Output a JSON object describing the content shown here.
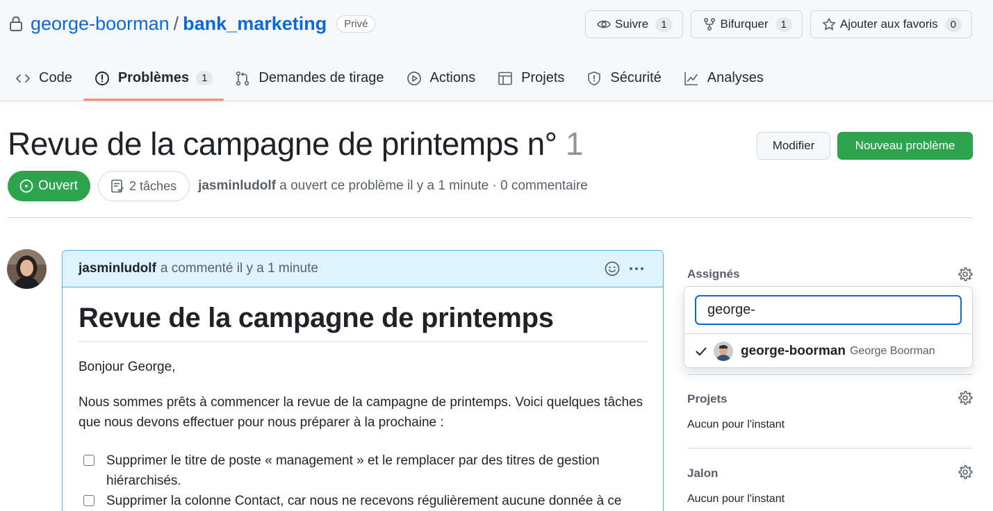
{
  "repo": {
    "owner": "george-boorman",
    "separator": "/",
    "name": "bank_marketing",
    "visibility": "Privé",
    "watch": {
      "label": "Suivre",
      "count": "1"
    },
    "fork": {
      "label": "Bifurquer",
      "count": "1"
    },
    "star": {
      "label": "Ajouter aux favoris",
      "count": "0"
    }
  },
  "tabs": [
    {
      "label": "Code",
      "icon": "code-icon"
    },
    {
      "label": "Problèmes",
      "icon": "issue-opened-icon",
      "count": "1",
      "active": true
    },
    {
      "label": "Demandes de tirage",
      "icon": "git-pull-request-icon"
    },
    {
      "label": "Actions",
      "icon": "play-icon"
    },
    {
      "label": "Projets",
      "icon": "table-icon"
    },
    {
      "label": "Sécurité",
      "icon": "shield-icon"
    },
    {
      "label": "Analyses",
      "icon": "graph-icon"
    }
  ],
  "issue": {
    "title": "Revue de la campagne de printemps n°",
    "number": "1",
    "edit_label": "Modifier",
    "new_issue_label": "Nouveau problème",
    "state": "Ouvert",
    "tasks": "2 tâches",
    "author": "jasminludolf",
    "meta_text": "a ouvert ce problème il y a 1 minute · 0 commentaire"
  },
  "comment": {
    "author": "jasminludolf",
    "header_text": "a commenté il y a 1 minute",
    "heading": "Revue de la campagne de printemps",
    "greeting": "Bonjour George,",
    "paragraph": "Nous sommes prêts à commencer la revue de la campagne de printemps. Voici quelques tâches que nous devons effectuer pour nous préparer à la prochaine :",
    "tasks": [
      "Supprimer le titre de poste « management » et le remplacer par des titres de gestion hiérarchisés.",
      "Supprimer la colonne Contact, car nous ne recevons régulièrement aucune donnée à ce"
    ]
  },
  "sidebar": {
    "assignees_label": "Assignés",
    "search_value": "george-",
    "assignee_login": "george-boorman",
    "assignee_name": "George Boorman",
    "projects_label": "Projets",
    "projects_value": "Aucun pour l'instant",
    "milestone_label": "Jalon",
    "milestone_value": "Aucun pour l'instant"
  },
  "colors": {
    "accent": "#0969da",
    "success": "#2da44e",
    "tab_underline": "#fd8c73",
    "comment_header": "#ddf4ff"
  }
}
